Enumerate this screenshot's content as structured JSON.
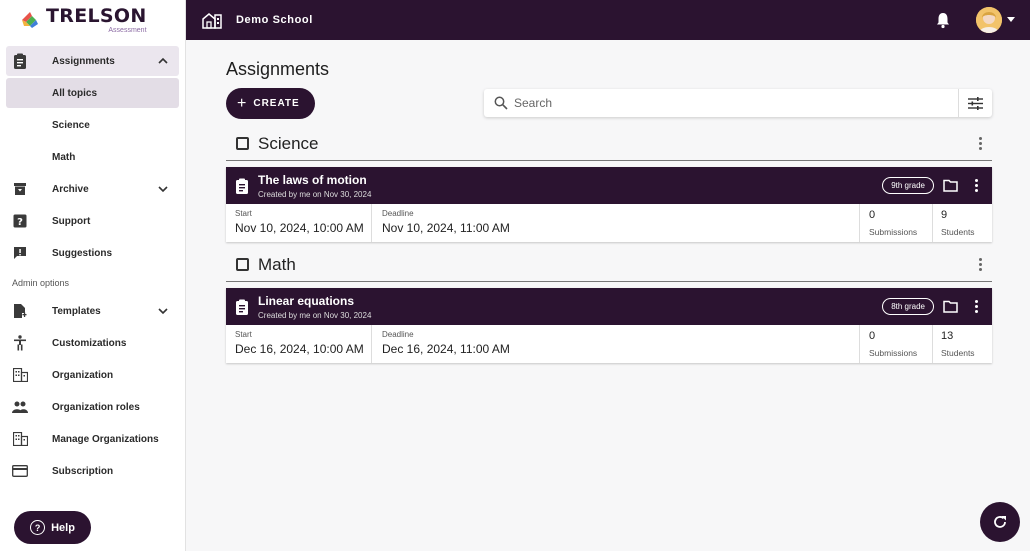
{
  "logo": {
    "title": "TRELSON",
    "subtitle": "Assessment"
  },
  "topbar": {
    "school_name": "Demo School"
  },
  "sidebar": {
    "items": [
      {
        "label": "Assignments",
        "icon": "clipboard-icon"
      },
      {
        "label": "All topics"
      },
      {
        "label": "Science"
      },
      {
        "label": "Math"
      },
      {
        "label": "Archive",
        "icon": "archive-icon"
      },
      {
        "label": "Support",
        "icon": "help-box-icon"
      },
      {
        "label": "Suggestions",
        "icon": "feedback-icon"
      }
    ],
    "admin_label": "Admin options",
    "admin_items": [
      {
        "label": "Templates",
        "icon": "file-add-icon"
      },
      {
        "label": "Customizations",
        "icon": "accessibility-icon"
      },
      {
        "label": "Organization",
        "icon": "building-icon"
      },
      {
        "label": "Organization roles",
        "icon": "people-icon"
      },
      {
        "label": "Manage Organizations",
        "icon": "building-icon"
      },
      {
        "label": "Subscription",
        "icon": "credit-card-icon"
      }
    ],
    "help_label": "Help"
  },
  "main": {
    "title": "Assignments",
    "create_label": "CREATE",
    "search_placeholder": "Search",
    "groups": [
      {
        "name": "Science",
        "assignment": {
          "title": "The laws of motion",
          "created": "Created by me on Nov 30, 2024",
          "grade": "9th grade",
          "start_label": "Start",
          "start": "Nov 10, 2024, 10:00 AM",
          "deadline_label": "Deadline",
          "deadline": "Nov 10, 2024, 11:00 AM",
          "submissions": "0",
          "submissions_label": "Submissions",
          "students": "9",
          "students_label": "Students"
        }
      },
      {
        "name": "Math",
        "assignment": {
          "title": "Linear equations",
          "created": "Created by me on Nov 30, 2024",
          "grade": "8th grade",
          "start_label": "Start",
          "start": "Dec 16, 2024, 10:00 AM",
          "deadline_label": "Deadline",
          "deadline": "Dec 16, 2024, 11:00 AM",
          "submissions": "0",
          "submissions_label": "Submissions",
          "students": "13",
          "students_label": "Students"
        }
      }
    ]
  },
  "colors": {
    "primary": "#2b1330",
    "active_bg": "#ebe6ee"
  }
}
